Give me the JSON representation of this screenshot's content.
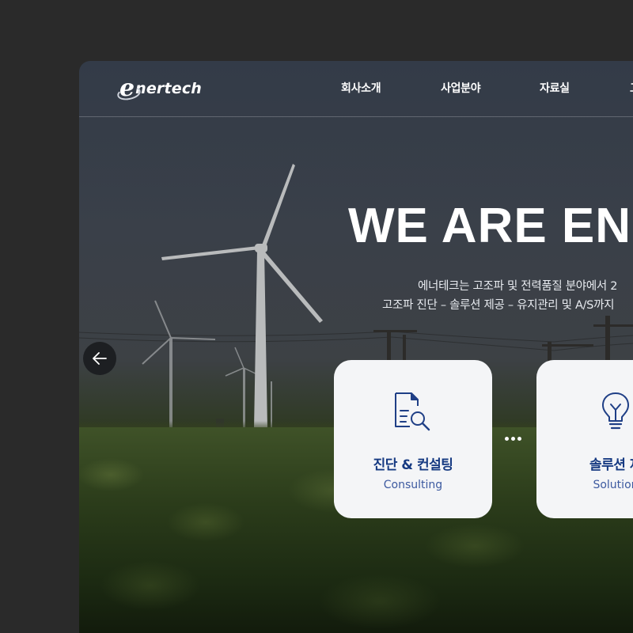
{
  "brand": {
    "logo_initial": "e",
    "logo_rest": "nertech"
  },
  "nav": {
    "items": [
      {
        "label": "회사소개"
      },
      {
        "label": "사업분야"
      },
      {
        "label": "자료실"
      },
      {
        "label": "고"
      }
    ]
  },
  "hero": {
    "title": "WE ARE EN",
    "subtitle_line1": "에너테크는 고조파 및 전력품질 분야에서 2",
    "subtitle_line2": "고조파 진단 – 솔루션 제공 – 유지관리 및 A/S까지"
  },
  "carousel": {
    "prev_icon": "arrow-left-icon"
  },
  "cards": [
    {
      "title": "진단 & 컨설팅",
      "subtitle": "Consulting",
      "icon": "document-search-icon"
    },
    {
      "title": "솔루션 제",
      "subtitle": "Solution",
      "icon": "lightbulb-icon"
    }
  ],
  "colors": {
    "page_bg": "#2a2a2a",
    "card_bg": "#f4f5f7",
    "card_title": "#163a82",
    "card_sub": "#3d5aa0",
    "icon_accent": "#1f3f86"
  }
}
